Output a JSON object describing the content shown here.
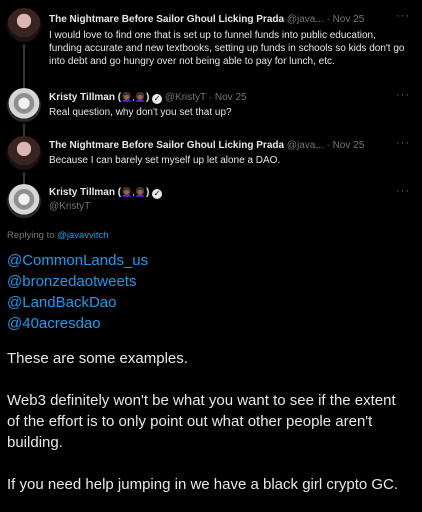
{
  "tweets": [
    {
      "name": "The Nightmare Before Sailor Ghoul Licking Prada",
      "handle": "@java...",
      "separator": "·",
      "date": "Nov 25",
      "text": "I would love to find one that is set up to funnel funds into public education, funding accurate and new textbooks, setting up funds in schools so kids don't go into debt and go hungry over not being able to pay for lunch, etc."
    },
    {
      "name": "Kristy Tillman (",
      "emoji": "👩🏾‍🦱,👩🏾‍🦱",
      "name_end": ")",
      "handle": "@KristyT",
      "separator": "·",
      "date": "Nov 25",
      "text": "Real question, why don't you set that up?"
    },
    {
      "name": "The Nightmare Before Sailor Ghoul Licking Prada",
      "handle": "@java...",
      "separator": "·",
      "date": "Nov 25",
      "text": "Because I can barely set myself up let alone a DAO."
    }
  ],
  "main": {
    "name": "Kristy Tillman (",
    "emoji": "👩🏾‍🦱,👩🏾‍🦱",
    "name_end": ")",
    "handle": "@KristyT",
    "replying_prefix": "Replying to",
    "replying_handle": "@javavvitch",
    "links": [
      "@CommonLands_us",
      "@bronzedaotweets",
      "@LandBackDao",
      "@40acresdao"
    ],
    "paragraphs": [
      "These are some examples.",
      "Web3 definitely won't be what you want to see if the extent of the effort is to only point out what other people aren't building.",
      "If you need help jumping in we have a black girl crypto GC."
    ]
  },
  "icons": {
    "more": "more-horizontal-icon",
    "verified": "verified-badge-icon"
  },
  "colors": {
    "background": "#000000",
    "text": "#e7e9ea",
    "muted": "#71767b",
    "link": "#1d9bf0",
    "thread_line": "#333639"
  }
}
